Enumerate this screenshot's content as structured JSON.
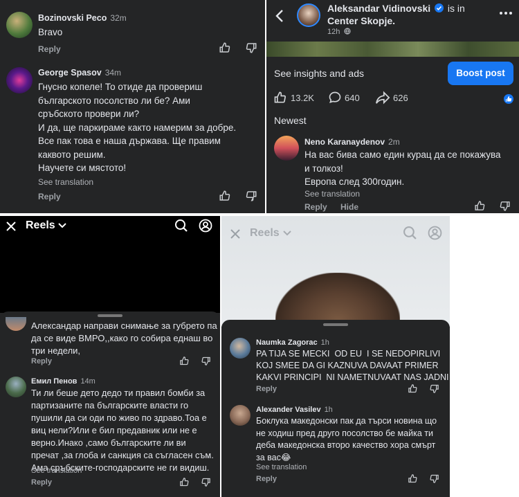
{
  "panel1": {
    "comments": [
      {
        "author": "Bozinovski Peco",
        "time": "32m",
        "text": "Bravo",
        "reply": "Reply"
      },
      {
        "author": "George Spasov",
        "time": "34m",
        "text": "Гнусно копеле! То отиде да провериш\nбългарското посолство ли бе? Ами\nсръбското провери ли?\nИ да, ще паркираме както намерим за добре.\nВсе пак това е наша държава. Ще правим\nкаквото решим.\nНаучете си мястото!",
        "see_translation": "See translation",
        "reply": "Reply"
      }
    ]
  },
  "panel2": {
    "author": "Aleksandar Vidinovski",
    "checkin": "is in",
    "location": "Center Skopje.",
    "time": "12h",
    "insights": "See insights and ads",
    "boost": "Boost post",
    "likes": "13.2K",
    "comments": "640",
    "shares": "626",
    "sort": "Newest",
    "comment": {
      "author": "Neno Karanaydenov",
      "time": "2m",
      "text": "На вас бива само един курац да се покажува\nи толкоз!\nЕвропа след 300годин.",
      "see_translation": "See translation",
      "reply": "Reply",
      "hide": "Hide"
    }
  },
  "panel3": {
    "title": "Reels",
    "comments": [
      {
        "text": "Александар направи снимање за губрето па\nда се виде ВМРО,,како го собира еднаш во\nтри недели,",
        "reply": "Reply"
      },
      {
        "author": "Емил Пенов",
        "time": "14m",
        "text": "Ти ли беше дето дедо ти правил бомби за\nпартизаните па българските власти го\nпушили да си оди по живо по здраво.Тоа е\nвиц нели?Или е бил предавник или не е\nверно.Инако ,само българските ли ви\nпречат ,за глоба и санкция са съгласен съм.\nАма сръбските-господарските не ги видиш.",
        "see_translation": "See translation",
        "reply": "Reply"
      }
    ]
  },
  "panel4": {
    "title": "Reels",
    "comments": [
      {
        "author": "Naumka Zagorac",
        "time": "1h",
        "text": "PA TIJA SE MECKI  OD EU  I SE NEDOPIRLIVI\nKOJ SMEE DA GI KAZNUVA DAVAAT PRIMER\nKAKVI PRINCIPI  NI NAMETNUVAAT NAS JADNI",
        "reply": "Reply"
      },
      {
        "author": "Alexander Vasilev",
        "time": "1h",
        "text": "Боклука македонски пак да търси новина що\nне ходиш пред друго посолство бе майка ти\nдеба македонска второ качество хора смърт\nза вас😂",
        "see_translation": "See translation",
        "reply": "Reply"
      }
    ]
  },
  "colors": {
    "panel_bg": "#242526",
    "text": "#e4e6eb",
    "muted": "#9da1a6",
    "accent": "#1877f2"
  },
  "icons": [
    "like-icon",
    "dislike-icon",
    "back-icon",
    "verified-icon",
    "more-icon",
    "comment-icon",
    "share-icon",
    "close-icon",
    "chevron-down-icon",
    "search-icon",
    "profile-icon",
    "globe-icon"
  ]
}
